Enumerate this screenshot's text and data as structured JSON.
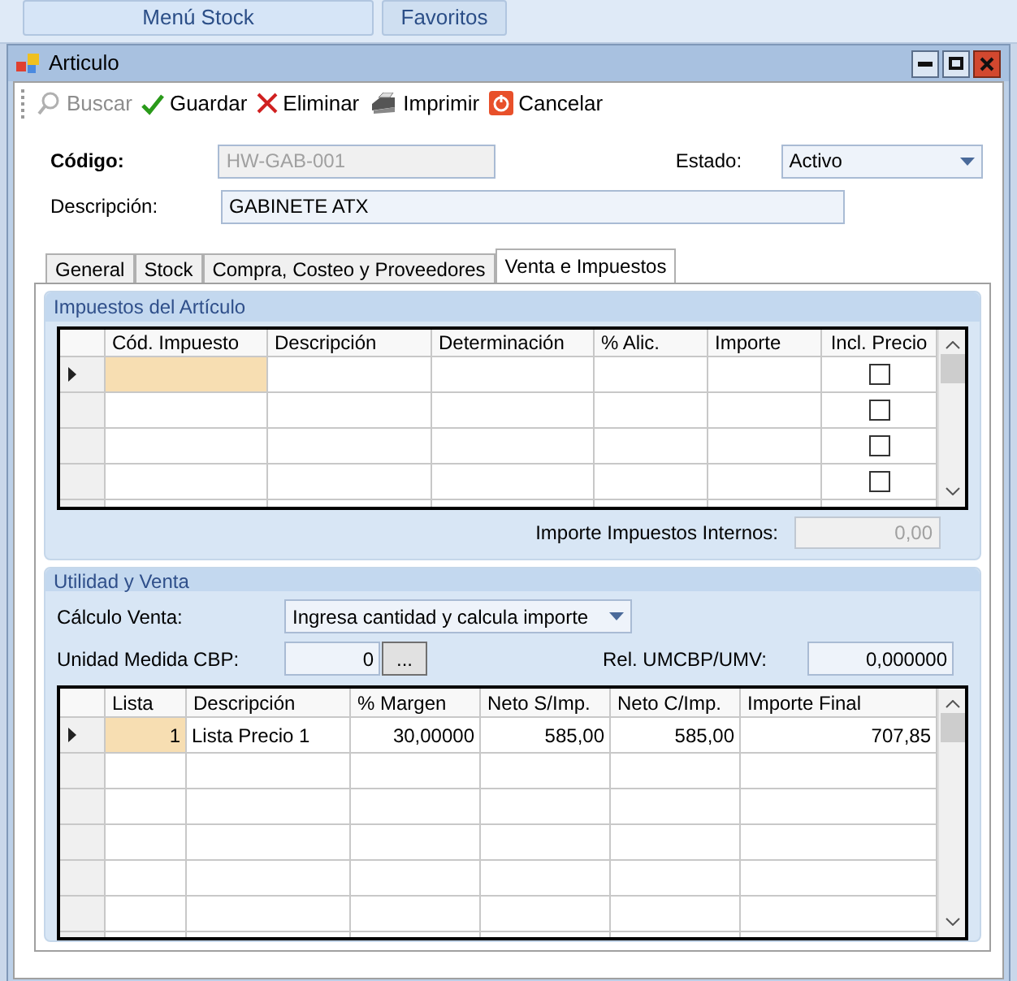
{
  "ribbon_tabs": [
    "Menú Stock",
    "Favoritos"
  ],
  "window": {
    "title": "Articulo"
  },
  "toolbar": [
    {
      "kind": "search",
      "label": "Buscar",
      "disabled": true
    },
    {
      "kind": "check",
      "label": "Guardar",
      "disabled": false
    },
    {
      "kind": "delete",
      "label": "Eliminar",
      "disabled": false
    },
    {
      "kind": "print",
      "label": "Imprimir",
      "disabled": false
    },
    {
      "kind": "cancel",
      "label": "Cancelar",
      "disabled": false
    }
  ],
  "codigo": {
    "label": "Código:",
    "value": "HW-GAB-001",
    "disabled": true
  },
  "estado": {
    "label": "Estado:",
    "value": "Activo"
  },
  "descripcion": {
    "label": "Descripción:",
    "value": "GABINETE ATX"
  },
  "tabs": [
    {
      "label": "General",
      "selected": false
    },
    {
      "label": "Stock",
      "selected": false
    },
    {
      "label": "Compra, Costeo y Proveedores",
      "selected": false
    },
    {
      "label": "Venta e Impuestos",
      "selected": true
    }
  ],
  "impuestos": {
    "title": "Impuestos del Artículo",
    "columns": [
      "Cód. Impuesto",
      "Descripción",
      "Determinación",
      "% Alic.",
      "Importe",
      "Incl. Precio"
    ],
    "rows": [
      {
        "selected": true,
        "checked": false
      },
      {
        "selected": false,
        "checked": false
      },
      {
        "selected": false,
        "checked": false
      },
      {
        "selected": false,
        "checked": false
      }
    ],
    "total_label": "Importe Impuestos Internos:",
    "total_value": "0,00"
  },
  "utilidad": {
    "title": "Utilidad y Venta",
    "calculo_label": "Cálculo Venta:",
    "calculo_value": "Ingresa cantidad y calcula importe",
    "unidad_label": "Unidad Medida CBP:",
    "unidad_value": "0",
    "unidad_button": "...",
    "rel_label": "Rel. UMCBP/UMV:",
    "rel_value": "0,000000",
    "columns": [
      "Lista",
      "Descripción",
      "% Margen",
      "Neto S/Imp.",
      "Neto C/Imp.",
      "Importe Final"
    ],
    "rows": [
      {
        "selected": true,
        "cells": [
          "1",
          "Lista Precio 1",
          "30,00000",
          "585,00",
          "585,00",
          "707,85"
        ]
      }
    ]
  }
}
